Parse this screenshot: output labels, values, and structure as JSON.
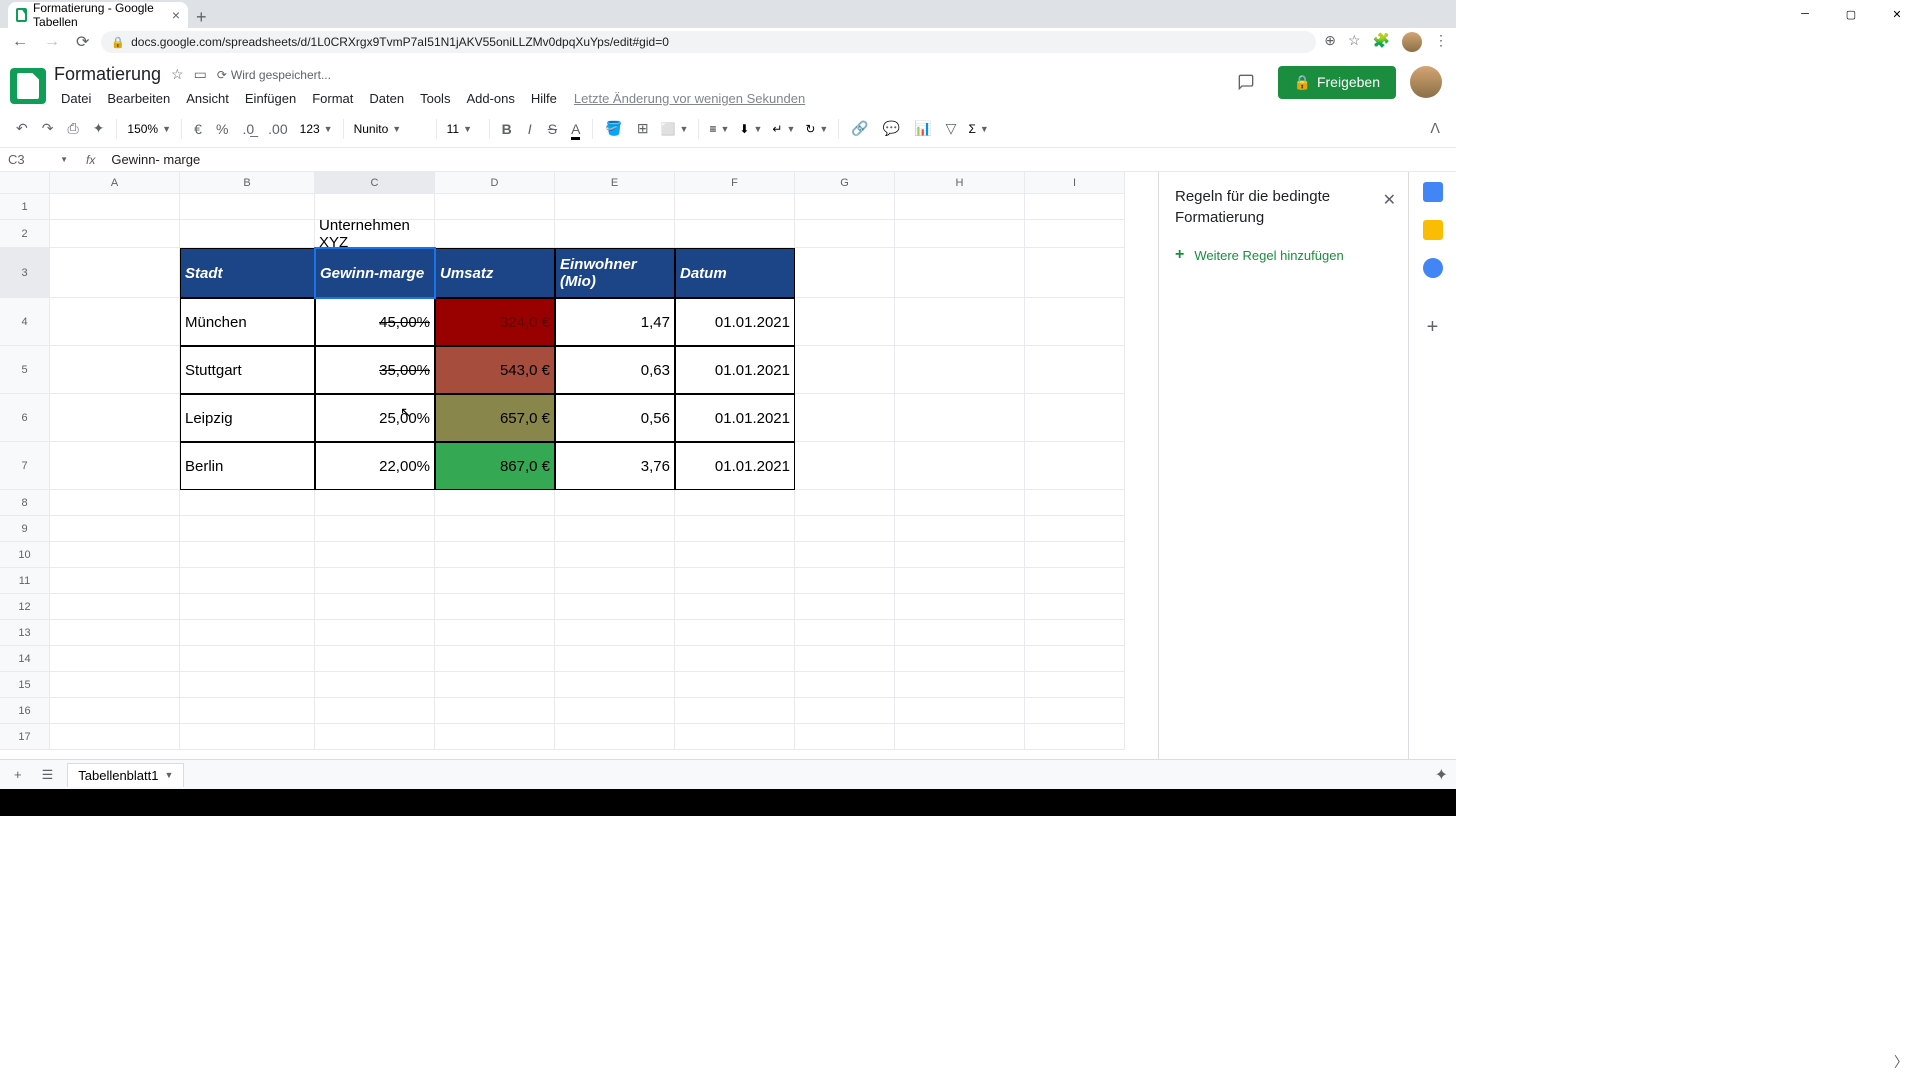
{
  "browser": {
    "tab_title": "Formatierung - Google Tabellen",
    "url": "docs.google.com/spreadsheets/d/1L0CRXrgx9TvmP7aI51N1jAKV55oniLLZMv0dpqXuYps/edit#gid=0"
  },
  "doc": {
    "title": "Formatierung",
    "saving": "Wird gespeichert...",
    "last_edit": "Letzte Änderung vor wenigen Sekunden"
  },
  "menu": {
    "file": "Datei",
    "edit": "Bearbeiten",
    "view": "Ansicht",
    "insert": "Einfügen",
    "format": "Format",
    "data": "Daten",
    "tools": "Tools",
    "addons": "Add-ons",
    "help": "Hilfe"
  },
  "toolbar": {
    "zoom": "150%",
    "currency": "€",
    "percent": "%",
    "dec_dec": ".0",
    "dec_inc": ".00",
    "num_fmt": "123",
    "font": "Nunito",
    "font_size": "11"
  },
  "namebox": "C3",
  "formula": "Gewinn- marge",
  "columns": [
    "A",
    "B",
    "C",
    "D",
    "E",
    "F",
    "G",
    "H",
    "I"
  ],
  "sheet": {
    "title": "Unternehmen XYZ",
    "headers": {
      "stadt": "Stadt",
      "gewinn": "Gewinn-marge",
      "umsatz": "Umsatz",
      "einwohner": "Einwohner (Mio)",
      "datum": "Datum"
    },
    "rows": [
      {
        "stadt": "München",
        "gewinn": "45,00%",
        "umsatz": "324,0 €",
        "einwohner": "1,47",
        "datum": "01.01.2021",
        "strike": true,
        "umsatz_bg": "bg-red"
      },
      {
        "stadt": "Stuttgart",
        "gewinn": "35,00%",
        "umsatz": "543,0 €",
        "einwohner": "0,63",
        "datum": "01.01.2021",
        "strike": true,
        "umsatz_bg": "bg-brown"
      },
      {
        "stadt": "Leipzig",
        "gewinn": "25,00%",
        "umsatz": "657,0 €",
        "einwohner": "0,56",
        "datum": "01.01.2021",
        "strike": false,
        "umsatz_bg": "bg-olive"
      },
      {
        "stadt": "Berlin",
        "gewinn": "22,00%",
        "umsatz": "867,0 €",
        "einwohner": "3,76",
        "datum": "01.01.2021",
        "strike": false,
        "umsatz_bg": "bg-green"
      }
    ]
  },
  "sidepanel": {
    "title": "Regeln für die bedingte Formatierung",
    "add_rule": "Weitere Regel hinzufügen"
  },
  "share": "Freigeben",
  "sheet_tab": "Tabellenblatt1"
}
